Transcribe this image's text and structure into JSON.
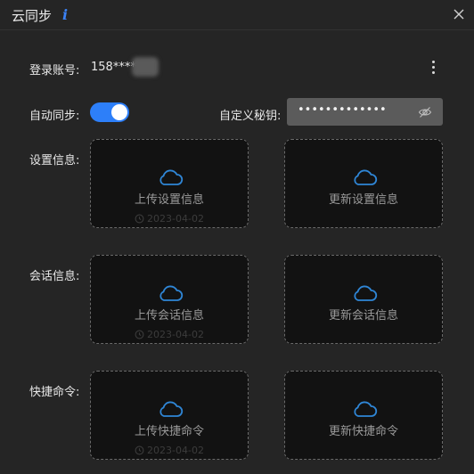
{
  "window": {
    "title": "云同步",
    "info_glyph": "i"
  },
  "account": {
    "label": "登录账号:",
    "value": "158****"
  },
  "auto_sync": {
    "label": "自动同步:",
    "enabled": true
  },
  "secret": {
    "label": "自定义秘钥:",
    "masked_value": "•••••••••••••"
  },
  "sections": [
    {
      "label": "设置信息:",
      "upload": {
        "label": "上传设置信息",
        "time": "2023-04-02"
      },
      "update": {
        "label": "更新设置信息"
      }
    },
    {
      "label": "会话信息:",
      "upload": {
        "label": "上传会话信息",
        "time": "2023-04-02"
      },
      "update": {
        "label": "更新会话信息"
      }
    },
    {
      "label": "快捷命令:",
      "upload": {
        "label": "上传快捷命令",
        "time": "2023-04-02"
      },
      "update": {
        "label": "更新快捷命令"
      }
    }
  ],
  "colors": {
    "accent": "#2d7ff9",
    "cloud_icon": "#2f86d6",
    "background": "#252525"
  }
}
